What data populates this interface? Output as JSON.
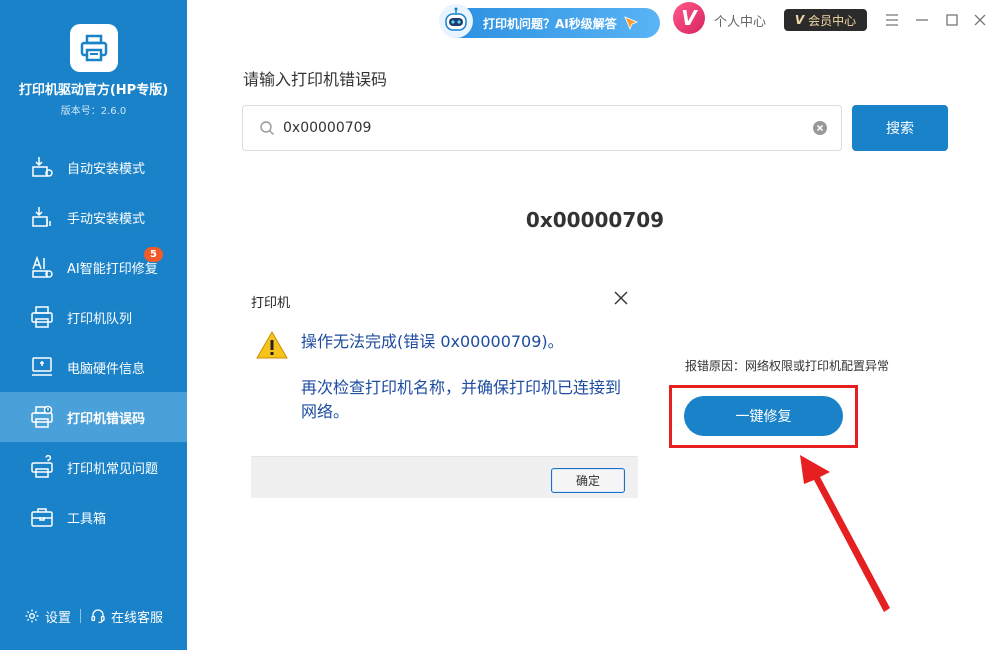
{
  "sidebar": {
    "app_name": "打印机驱动官方(HP专版)",
    "version": "版本号：2.6.0",
    "items": [
      {
        "label": "自动安装模式",
        "icon": "auto-install-icon"
      },
      {
        "label": "手动安装模式",
        "icon": "manual-install-icon"
      },
      {
        "label": "AI智能打印修复",
        "icon": "ai-repair-icon",
        "badge": "5"
      },
      {
        "label": "打印机队列",
        "icon": "printer-queue-icon"
      },
      {
        "label": "电脑硬件信息",
        "icon": "hardware-info-icon"
      },
      {
        "label": "打印机错误码",
        "icon": "printer-error-icon",
        "active": true
      },
      {
        "label": "打印机常见问题",
        "icon": "printer-faq-icon"
      },
      {
        "label": "工具箱",
        "icon": "toolbox-icon"
      }
    ],
    "settings_label": "设置",
    "support_label": "在线客服"
  },
  "topbar": {
    "ai_pill_label": "打印机问题？AI秒级解答",
    "avatar_letter": "V",
    "personal_center": "个人中心",
    "vip_center": "会员中心",
    "vip_letter": "V"
  },
  "main": {
    "section_title": "请输入打印机错误码",
    "search_value": "0x00000709",
    "search_button": "搜索",
    "error_code_heading": "0x00000709",
    "dialog": {
      "title": "打印机",
      "message": "操作无法完成(错误 0x00000709)。",
      "detail": "再次检查打印机名称，并确保打印机已连接到网络。",
      "ok_button": "确定"
    },
    "reason": "报错原因：网络权限或打印机配置异常",
    "fix_button": "一键修复"
  },
  "colors": {
    "sidebar_bg": "#1a82c8",
    "accent": "#1a82c8",
    "highlight": "#e62020",
    "dialog_text": "#1d4ca0"
  }
}
